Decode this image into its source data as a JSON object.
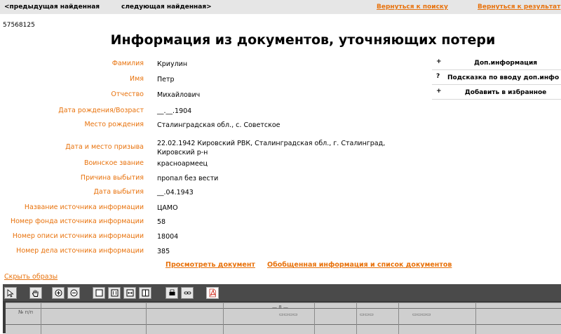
{
  "topbar": {
    "prev_found": "<предыдущая найденная",
    "next_found": "следующая найденная>",
    "back_to_search": "Вернуться к поиску",
    "back_to_results": "Вернуться к результат"
  },
  "record_id": "57568125",
  "page_title": "Информация из документов, уточняющих потери",
  "fields": [
    {
      "label": "Фамилия",
      "value": "Криулин"
    },
    {
      "label": "Имя",
      "value": "Петр"
    },
    {
      "label": "Отчество",
      "value": "Михайлович"
    },
    {
      "label": "Дата рождения/Возраст",
      "value": "__.__.1904"
    },
    {
      "label": "Место рождения",
      "value": "Сталинградская обл., с. Советское"
    },
    {
      "label": "Дата и место призыва",
      "value": "22.02.1942 Кировский РВК, Сталинградская обл., г. Сталинград, Кировский р-н"
    },
    {
      "label": "Воинское звание",
      "value": "красноармеец"
    },
    {
      "label": "Причина выбытия",
      "value": "пропал без вести"
    },
    {
      "label": "Дата выбытия",
      "value": "__.04.1943"
    },
    {
      "label": "Название источника информации",
      "value": "ЦАМО"
    },
    {
      "label": "Номер фонда источника информации",
      "value": "58"
    },
    {
      "label": "Номер описи источника информации",
      "value": "18004"
    },
    {
      "label": "Номер дела источника информации",
      "value": "385"
    }
  ],
  "actions": {
    "view_document": "Просмотреть документ",
    "summary": "Обобщенная информация и список документов",
    "hide_images": "Скрыть образы"
  },
  "side_panel": [
    {
      "icon": "+",
      "label": "Доп.информация"
    },
    {
      "icon": "?",
      "label": "Подсказка по вводу доп.инфо"
    },
    {
      "icon": "+",
      "label": "Добавить в избранное"
    }
  ],
  "viewer": {
    "tools": [
      "pointer-icon",
      "hand-icon",
      "zoom-in-icon",
      "zoom-out-icon",
      "fit-page-icon",
      "actual-size-icon",
      "fit-width-icon",
      "two-page-icon",
      "print-icon",
      "link-icon",
      "pdf-icon"
    ]
  }
}
